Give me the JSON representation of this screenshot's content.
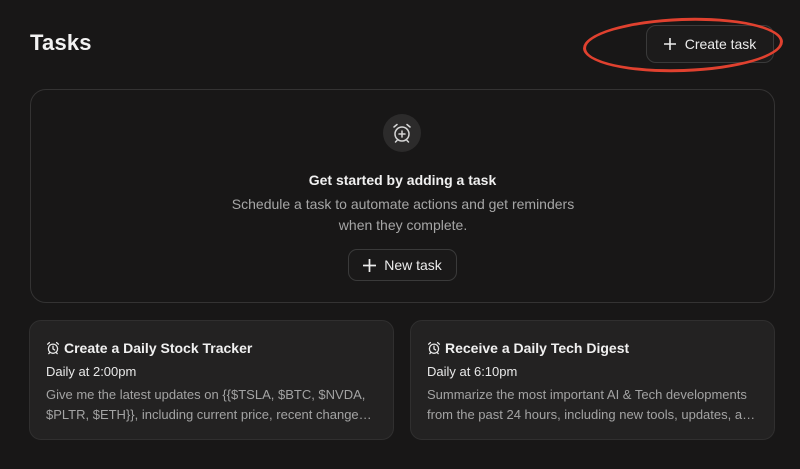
{
  "header": {
    "title": "Tasks",
    "create_button": {
      "label": "Create task",
      "icon": "plus-icon"
    }
  },
  "empty_state": {
    "icon": "alarm-plus-icon",
    "heading": "Get started by adding a task",
    "description": "Schedule a task to automate actions and get reminders when they complete.",
    "new_button": {
      "label": "New task",
      "icon": "plus-icon"
    }
  },
  "suggestions": [
    {
      "icon": "alarm-clock-icon",
      "title": "Create a Daily Stock Tracker",
      "time": "Daily at 2:00pm",
      "description": "Give me the latest updates on {{$TSLA, $BTC, $NVDA, $PLTR, $ETH}}, including current price, recent changes and news"
    },
    {
      "icon": "alarm-clock-icon",
      "title": "Receive a Daily Tech Digest",
      "time": "Daily at 6:10pm",
      "description": "Summarize the most important AI & Tech developments from the past 24 hours, including new tools, updates, and announcements"
    }
  ],
  "colors": {
    "background": "#181717",
    "card": "#232222",
    "border": "#343333",
    "annotation": "#e0412f",
    "muted_text": "#a6a6a6"
  }
}
